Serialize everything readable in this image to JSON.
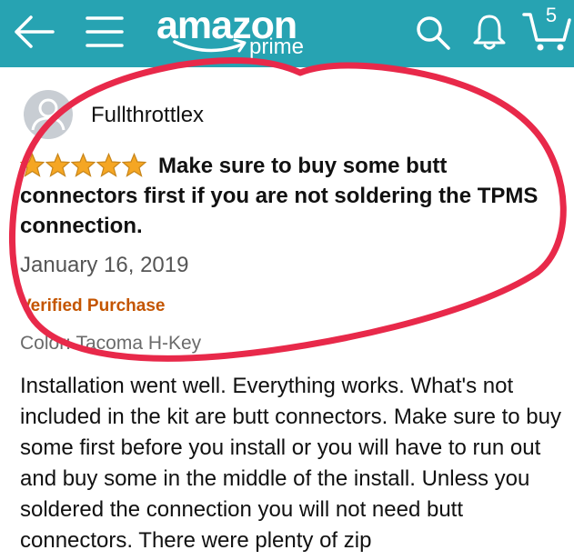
{
  "header": {
    "logo_text": "amazon",
    "logo_sub": "prime",
    "cart_count": "5",
    "icons": [
      "back-arrow-icon",
      "hamburger-menu-icon",
      "search-icon",
      "bell-icon",
      "cart-icon"
    ],
    "background_color": "#27a3b2"
  },
  "review": {
    "reviewer_name": "Fullthrottlex",
    "rating": 5,
    "rating_max": 5,
    "title": "Make sure to buy some butt connectors first if you are not soldering the TPMS connection.",
    "date": "January 16, 2019",
    "verified_label": "Verified Purchase",
    "color_line": "Color: Tacoma H-Key",
    "body": "Installation went well. Everything works. What's not included in the kit are butt connectors. Make sure to buy some first before you install or you will have to run out and buy some in the middle of the install. Unless you soldered the connection you will not need butt connectors. There were plenty of zip"
  },
  "colors": {
    "star": "#f5a623",
    "verified": "#c45500",
    "annotation": "#e8294a"
  }
}
